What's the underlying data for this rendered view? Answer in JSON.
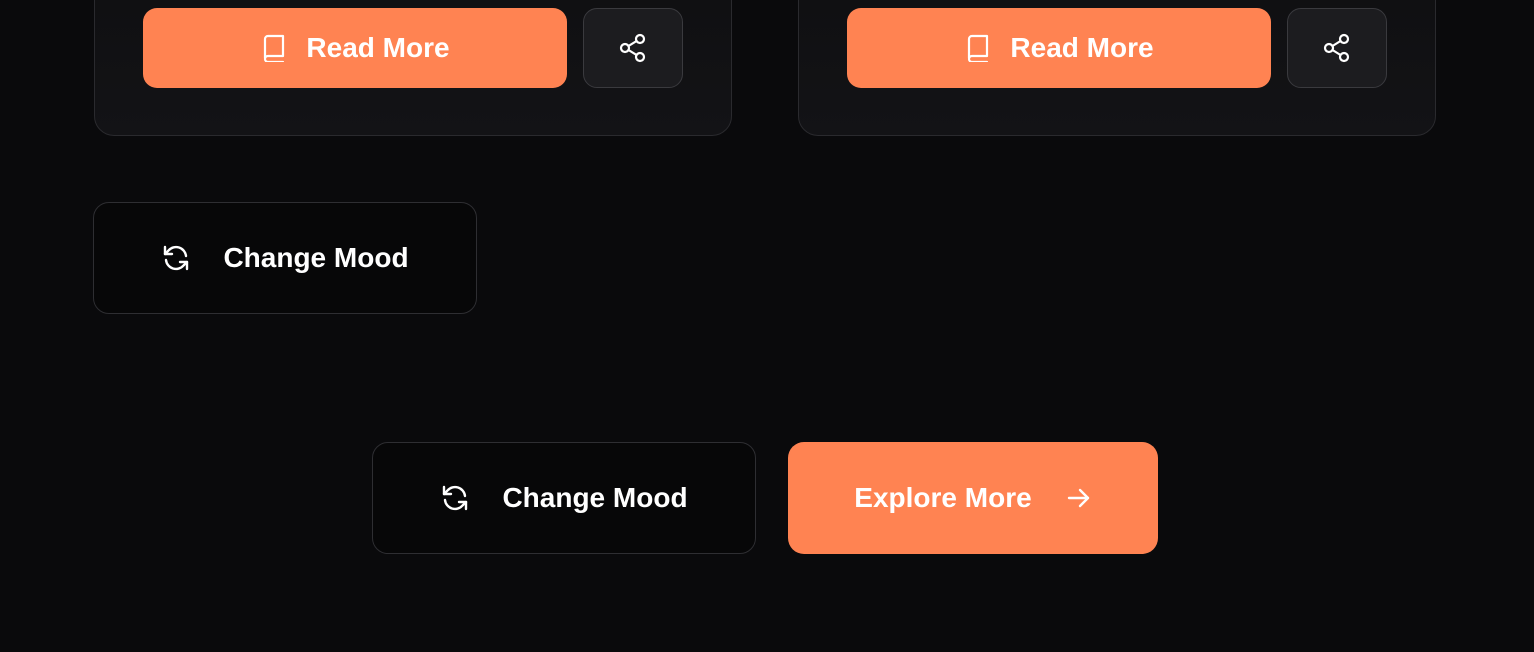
{
  "cards": [
    {
      "read_more_label": "Read More",
      "read_icon": "book-icon",
      "share_icon": "share-icon"
    },
    {
      "read_more_label": "Read More",
      "read_icon": "book-icon",
      "share_icon": "share-icon"
    }
  ],
  "mood_button": {
    "label": "Change Mood",
    "icon": "refresh-icon"
  },
  "footer": {
    "change_mood_label": "Change Mood",
    "change_mood_icon": "refresh-icon",
    "explore_label": "Explore More",
    "explore_icon": "arrow-right-icon"
  },
  "colors": {
    "accent": "#ff8352",
    "background": "#0a0a0c",
    "card_border": "#2a2a2e"
  }
}
